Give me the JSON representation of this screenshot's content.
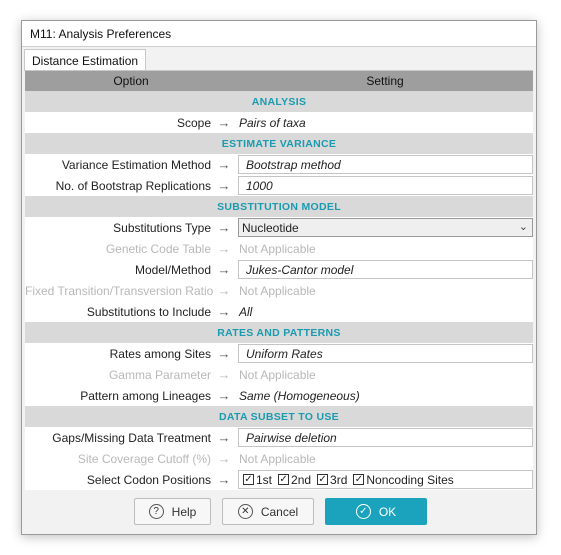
{
  "window": {
    "title": "M11: Analysis Preferences"
  },
  "tabs": [
    {
      "label": "Distance Estimation"
    }
  ],
  "grid": {
    "header_option": "Option",
    "header_setting": "Setting"
  },
  "arrow": "→",
  "sections": {
    "analysis": "ANALYSIS",
    "estimate_variance": "ESTIMATE VARIANCE",
    "substitution_model": "SUBSTITUTION MODEL",
    "rates_patterns": "RATES AND PATTERNS",
    "data_subset": "DATA SUBSET TO USE"
  },
  "rows": {
    "scope": {
      "label": "Scope",
      "value": "Pairs of taxa"
    },
    "variance_method": {
      "label": "Variance Estimation Method",
      "value": "Bootstrap method"
    },
    "bootstrap_reps": {
      "label": "No. of Bootstrap Replications",
      "value": "1000"
    },
    "subst_type": {
      "label": "Substitutions Type",
      "value": "Nucleotide"
    },
    "genetic_code": {
      "label": "Genetic Code Table",
      "value": "Not Applicable"
    },
    "model": {
      "label": "Model/Method",
      "value": "Jukes-Cantor model"
    },
    "fixed_ratio": {
      "label": "Fixed Transition/Transversion Ratio",
      "value": "Not Applicable"
    },
    "subst_include": {
      "label": "Substitutions to Include",
      "value": "All"
    },
    "rates_sites": {
      "label": "Rates among Sites",
      "value": "Uniform Rates"
    },
    "gamma": {
      "label": "Gamma Parameter",
      "value": "Not Applicable"
    },
    "pattern": {
      "label": "Pattern among Lineages",
      "value": "Same (Homogeneous)"
    },
    "gaps": {
      "label": "Gaps/Missing Data Treatment",
      "value": "Pairwise deletion"
    },
    "site_cov": {
      "label": "Site Coverage Cutoff (%)",
      "value": "Not Applicable"
    },
    "codon": {
      "label": "Select Codon Positions"
    }
  },
  "codon_positions": [
    {
      "label": "1st",
      "checked": true
    },
    {
      "label": "2nd",
      "checked": true
    },
    {
      "label": "3rd",
      "checked": true
    },
    {
      "label": "Noncoding Sites",
      "checked": true
    }
  ],
  "buttons": {
    "help": "Help",
    "cancel": "Cancel",
    "ok": "OK"
  },
  "icons": {
    "help": "question-circle-icon",
    "cancel": "x-circle-icon",
    "ok": "check-circle-icon",
    "dropdown": "chevron-down-icon",
    "checkbox": "checkmark-icon"
  },
  "colors": {
    "accent": "#1ba3bd",
    "section_text": "#1a9bb0",
    "header_bg": "#9e9e9e",
    "section_bg": "#d9d9d9"
  }
}
